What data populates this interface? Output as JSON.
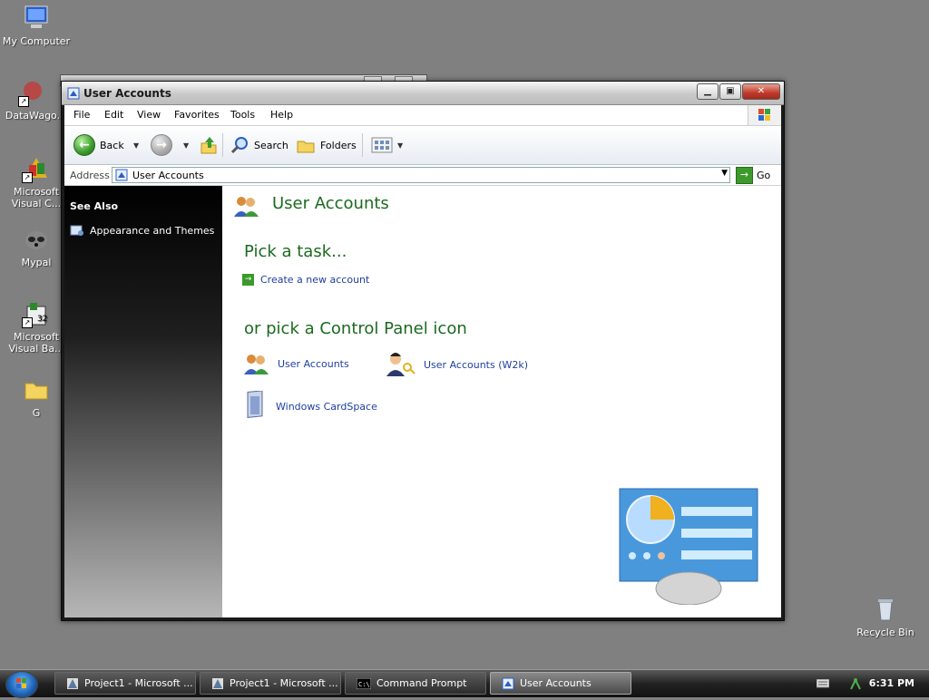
{
  "desktop": {
    "icons": [
      {
        "label": "My Computer"
      },
      {
        "label": "DataWago."
      },
      {
        "label": "Microsoft Visual C..."
      },
      {
        "label": "Mypal"
      },
      {
        "label": "Microsoft Visual Ba..."
      },
      {
        "label": "G"
      },
      {
        "label": "Recycle Bin"
      }
    ]
  },
  "window": {
    "title": "User Accounts",
    "menu": [
      "File",
      "Edit",
      "View",
      "Favorites",
      "Tools",
      "Help"
    ],
    "toolbar": {
      "back_label": "Back",
      "search_label": "Search",
      "folders_label": "Folders"
    },
    "address": {
      "label": "Address",
      "value": "User Accounts",
      "go_label": "Go"
    },
    "sidebar": {
      "heading": "See Also",
      "links": [
        {
          "label": "Appearance and Themes"
        }
      ]
    },
    "content": {
      "title": "User Accounts",
      "task_heading": "Pick a task...",
      "tasks": [
        {
          "label": "Create a new account"
        }
      ],
      "cp_heading": "or pick a Control Panel icon",
      "cp_icons": [
        {
          "label": "User Accounts"
        },
        {
          "label": "User Accounts (W2k)"
        },
        {
          "label": "Windows CardSpace"
        }
      ]
    }
  },
  "taskbar": {
    "buttons": [
      {
        "label": "Project1 - Microsoft ..."
      },
      {
        "label": "Project1 - Microsoft ..."
      },
      {
        "label": "Command Prompt"
      },
      {
        "label": "User Accounts"
      }
    ],
    "clock": "6:31 PM"
  },
  "colors": {
    "desktop": "#808080",
    "heading_green": "#1b6a1f",
    "link_blue": "#1f3fa0"
  }
}
